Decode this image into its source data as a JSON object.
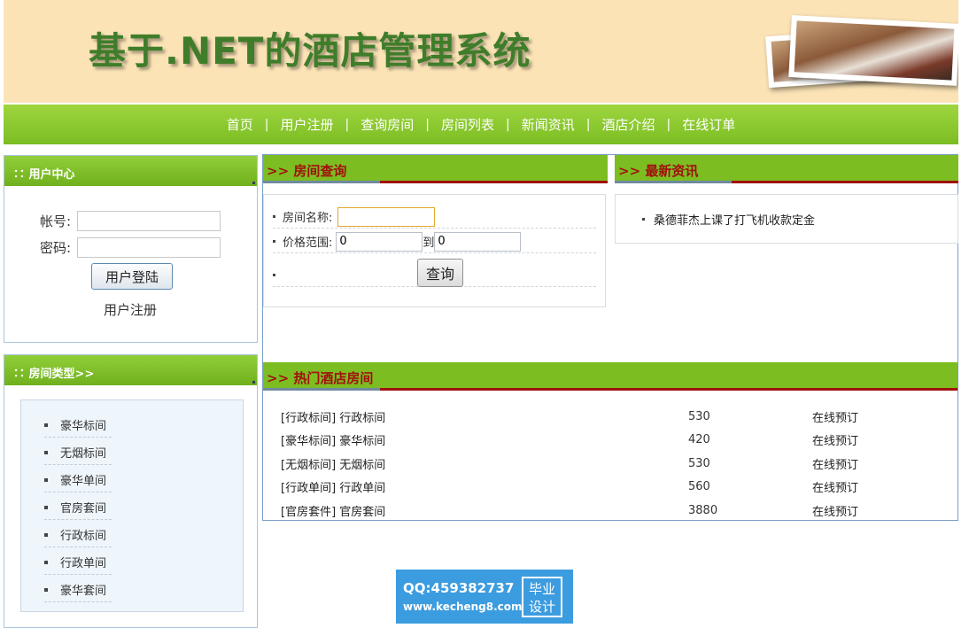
{
  "banner": {
    "title": "基于.NET的酒店管理系统"
  },
  "nav": {
    "items": [
      "首页",
      "用户注册",
      "查询房间",
      "房间列表",
      "新闻资讯",
      "酒店介绍",
      "在线订单"
    ],
    "separator": "|"
  },
  "user_center": {
    "title": "用户中心",
    "account_label": "帐号:",
    "password_label": "密码:",
    "account_value": "",
    "password_value": "",
    "login_button": "用户登陆",
    "register_link": "用户注册"
  },
  "room_types": {
    "title": "房间类型>>",
    "items": [
      "豪华标间",
      "无烟标间",
      "豪华单间",
      "官房套间",
      "行政标间",
      "行政单间",
      "豪华套间"
    ]
  },
  "room_search": {
    "title": ">> 房间查询",
    "name_label": "房间名称:",
    "name_value": "",
    "price_label": "价格范围:",
    "price_min": "0",
    "price_to": "到",
    "price_max": "0",
    "query_button": "查询"
  },
  "news": {
    "title": ">> 最新资讯",
    "items": [
      "桑德菲杰上课了打飞机收款定金"
    ]
  },
  "hot_rooms": {
    "title": ">> 热门酒店房间",
    "rows": [
      {
        "name": "[行政标间] 行政标间",
        "price": "530",
        "action": "在线预订"
      },
      {
        "name": "[豪华标间] 豪华标间",
        "price": "420",
        "action": "在线预订"
      },
      {
        "name": "[无烟标间] 无烟标间",
        "price": "530",
        "action": "在线预订"
      },
      {
        "name": "[行政单间] 行政单间",
        "price": "560",
        "action": "在线预订"
      },
      {
        "name": "[官房套件] 官房套间",
        "price": "3880",
        "action": "在线预订"
      }
    ]
  },
  "badge": {
    "qq": "QQ:459382737",
    "url": "www.kecheng8.com",
    "tag_line1": "毕业",
    "tag_line2": "设计"
  }
}
